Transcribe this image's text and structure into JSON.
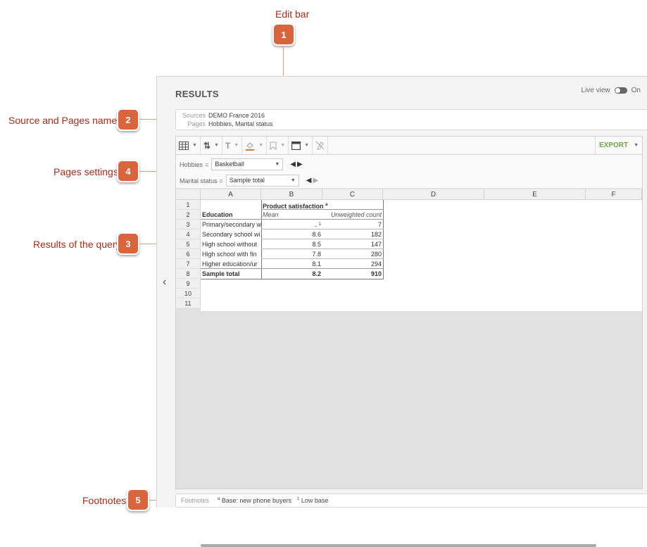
{
  "callouts": [
    {
      "number": "1",
      "label": "Edit bar"
    },
    {
      "number": "2",
      "label": "Source and Pages names"
    },
    {
      "number": "3",
      "label": "Results of the query"
    },
    {
      "number": "4",
      "label": "Pages settings"
    },
    {
      "number": "5",
      "label": "Footnotes"
    }
  ],
  "header": {
    "title": "RESULTS",
    "live_view_label": "Live view",
    "live_view_state": "On"
  },
  "sources": {
    "sources_label": "Sources",
    "sources_value": "DEMO France 2016",
    "pages_label": "Pages",
    "pages_value": "Hobbies, Marital status"
  },
  "toolbar": {
    "table_icon": "table-icon",
    "sort_icon": "sort-icon",
    "text_icon": "T",
    "fill_icon": "fill-color-icon",
    "bookmark_icon": "bookmark-icon",
    "layout_icon": "layout-icon",
    "clear_icon": "clear-icon",
    "export_label": "EXPORT"
  },
  "pages": [
    {
      "label": "Hobbies",
      "eq": "=",
      "value": "Basketball"
    },
    {
      "label": "Marital status",
      "eq": "=",
      "value": "Sample total"
    }
  ],
  "grid": {
    "columns": [
      "A",
      "B",
      "C",
      "D",
      "E",
      "F"
    ],
    "rows": [
      "1",
      "2",
      "3",
      "4",
      "5",
      "6",
      "7",
      "8",
      "9",
      "10",
      "11"
    ],
    "header_row1_b": "Product satisfaction",
    "header_row1_sup": "a",
    "header_row2_a": "Education",
    "header_row2_b": "Mean",
    "header_row2_c": "Unweighted count",
    "data": [
      {
        "a": "Primary/secondary w",
        "b": "- ",
        "b_sup": "1",
        "c": "7"
      },
      {
        "a": "Secondary school wi",
        "b": "8.6",
        "b_sup": "",
        "c": "182"
      },
      {
        "a": "High school without",
        "b": "8.5",
        "b_sup": "",
        "c": "147"
      },
      {
        "a": "High school with fin",
        "b": "7.8",
        "b_sup": "",
        "c": "280"
      },
      {
        "a": "Higher education/ur",
        "b": "8.1",
        "b_sup": "",
        "c": "294"
      },
      {
        "a": "Sample total",
        "b": "8.2",
        "b_sup": "",
        "c": "910"
      }
    ]
  },
  "footnotes": {
    "label": "Footnotes",
    "notes": [
      {
        "sup": "a",
        "text": "Base: new phone buyers"
      },
      {
        "sup": "1",
        "text": "Low base"
      }
    ]
  },
  "nav": {
    "back_icon": "chevron-left-icon"
  }
}
